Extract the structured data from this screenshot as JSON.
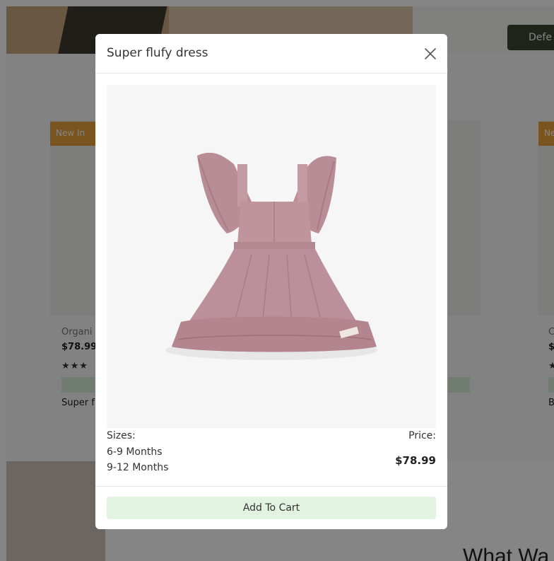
{
  "background": {
    "defer_button_label": "Defe",
    "badge_left": "New In",
    "badge_right": "Ne",
    "left_card": {
      "category": "Organi",
      "price": "$78.99",
      "stars": "★★★",
      "name": "Super f"
    },
    "right_card": {
      "category": "C",
      "price": "$",
      "stars": "★",
      "name": "B"
    },
    "bottom_heading": "What Wa"
  },
  "modal": {
    "title": "Super flufy dress",
    "close_icon": "close-icon",
    "image_icon": "dress-product-image",
    "sizes_label": "Sizes:",
    "sizes": [
      "6-9 Months",
      "9-12 Months"
    ],
    "price_label": "Price:",
    "price": "$78.99",
    "add_to_cart_label": "Add To Cart"
  },
  "colors": {
    "overlay": "#000000",
    "badge": "#e8a23a",
    "cart_button": "#e3f3e1",
    "dress": "#b98f97"
  }
}
